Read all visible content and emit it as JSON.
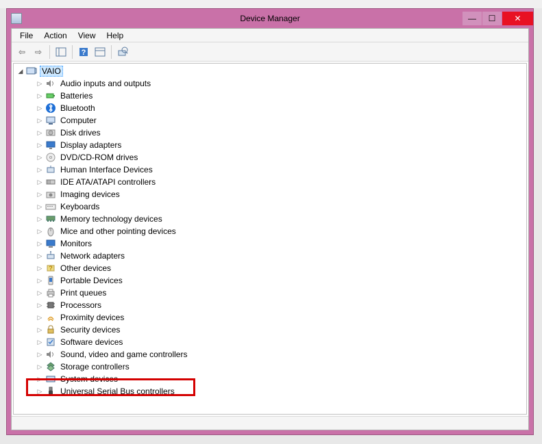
{
  "window": {
    "title": "Device Manager"
  },
  "menu": {
    "file": "File",
    "action": "Action",
    "view": "View",
    "help": "Help"
  },
  "tree": {
    "root": "VAIO",
    "items": [
      {
        "label": "Audio inputs and outputs",
        "icon": "speaker"
      },
      {
        "label": "Batteries",
        "icon": "battery"
      },
      {
        "label": "Bluetooth",
        "icon": "bluetooth"
      },
      {
        "label": "Computer",
        "icon": "computer"
      },
      {
        "label": "Disk drives",
        "icon": "disk"
      },
      {
        "label": "Display adapters",
        "icon": "display"
      },
      {
        "label": "DVD/CD-ROM drives",
        "icon": "cd"
      },
      {
        "label": "Human Interface Devices",
        "icon": "hid"
      },
      {
        "label": "IDE ATA/ATAPI controllers",
        "icon": "ide"
      },
      {
        "label": "Imaging devices",
        "icon": "camera"
      },
      {
        "label": "Keyboards",
        "icon": "keyboard"
      },
      {
        "label": "Memory technology devices",
        "icon": "memory"
      },
      {
        "label": "Mice and other pointing devices",
        "icon": "mouse"
      },
      {
        "label": "Monitors",
        "icon": "monitor"
      },
      {
        "label": "Network adapters",
        "icon": "network"
      },
      {
        "label": "Other devices",
        "icon": "other"
      },
      {
        "label": "Portable Devices",
        "icon": "portable"
      },
      {
        "label": "Print queues",
        "icon": "printer"
      },
      {
        "label": "Processors",
        "icon": "cpu"
      },
      {
        "label": "Proximity devices",
        "icon": "proximity"
      },
      {
        "label": "Security devices",
        "icon": "security"
      },
      {
        "label": "Software devices",
        "icon": "software"
      },
      {
        "label": "Sound, video and game controllers",
        "icon": "sound"
      },
      {
        "label": "Storage controllers",
        "icon": "storage"
      },
      {
        "label": "System devices",
        "icon": "system"
      },
      {
        "label": "Universal Serial Bus controllers",
        "icon": "usb"
      }
    ]
  }
}
